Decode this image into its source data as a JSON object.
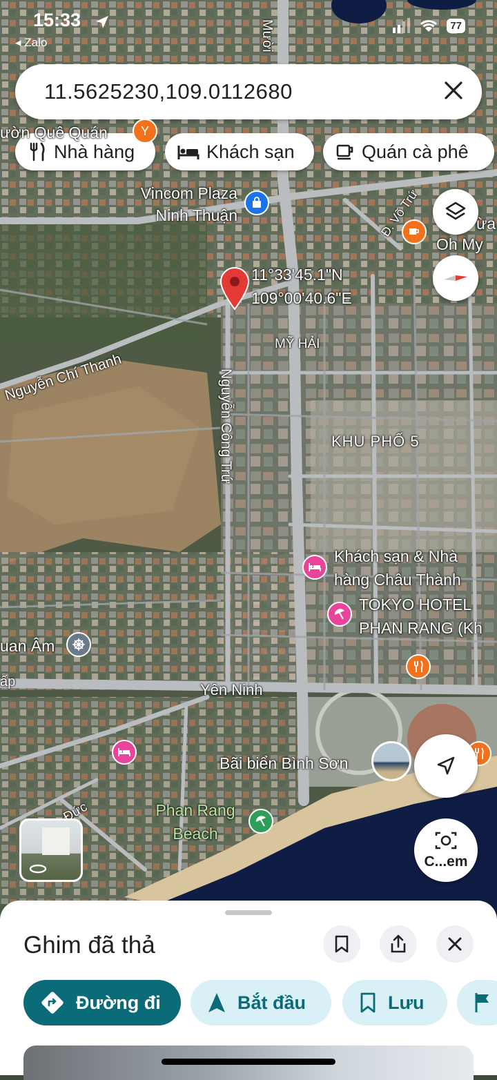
{
  "status_bar": {
    "time": "15:33",
    "back_app": "◂ Zalo",
    "battery": "77"
  },
  "search": {
    "value": "11.5625230,109.0112680"
  },
  "chips": [
    {
      "label": "Nhà hàng",
      "icon": "fork-knife-icon"
    },
    {
      "label": "Khách sạn",
      "icon": "bed-icon"
    },
    {
      "label": "Quán cà phê",
      "icon": "coffee-cup-icon"
    }
  ],
  "pin": {
    "lat": "11°33'45.1\"N",
    "lng": "109°00'40.6\"E"
  },
  "map_labels": {
    "vincom_1": "Vincom Plaza",
    "vincom_2": "Ninh Thuận",
    "vuon_que": "ườn Quê Quán",
    "vo_tru": "Đ. Võ Trứ",
    "muoi": "Mười",
    "ohmy": "Oh My",
    "ua": "ừa",
    "my_hai": "MỸ HẢI",
    "nguyen_chi_thanh": "Nguyễn Chí Thanh",
    "nguyen_cong_tru": "Nguyễn Công Trứ",
    "khu_pho": "KHU PHỐ 5",
    "chau_thanh_1": "Khách sạn & Nhà",
    "chau_thanh_2": "hàng Châu Thành",
    "tokyo_1": "TOKYO HOTEL",
    "tokyo_2": "PHAN RANG (Kh",
    "quan_am": "uan Âm",
    "ap": "ấp",
    "yen_ninh": "Yên Ninh",
    "bai_bien": "Bãi biển Bình Sơn",
    "phan_rang_1": "Phan Rang",
    "phan_rang_2": "Beach",
    "duc": "Đức"
  },
  "fabs": {
    "camera_label": "C...em"
  },
  "sheet": {
    "title": "Ghim đã thả",
    "actions": [
      {
        "label": "Đường đi",
        "icon": "directions-icon"
      },
      {
        "label": "Bắt đầu",
        "icon": "navigation-arrow-icon"
      },
      {
        "label": "Lưu",
        "icon": "bookmark-icon"
      }
    ]
  },
  "colors": {
    "primary_teal": "#0b6b78",
    "light_teal": "#d9f0f6",
    "pin_red": "#e53935",
    "poi_orange": "#f2711c",
    "poi_pink": "#e8449a",
    "poi_blue": "#1a73e8"
  }
}
